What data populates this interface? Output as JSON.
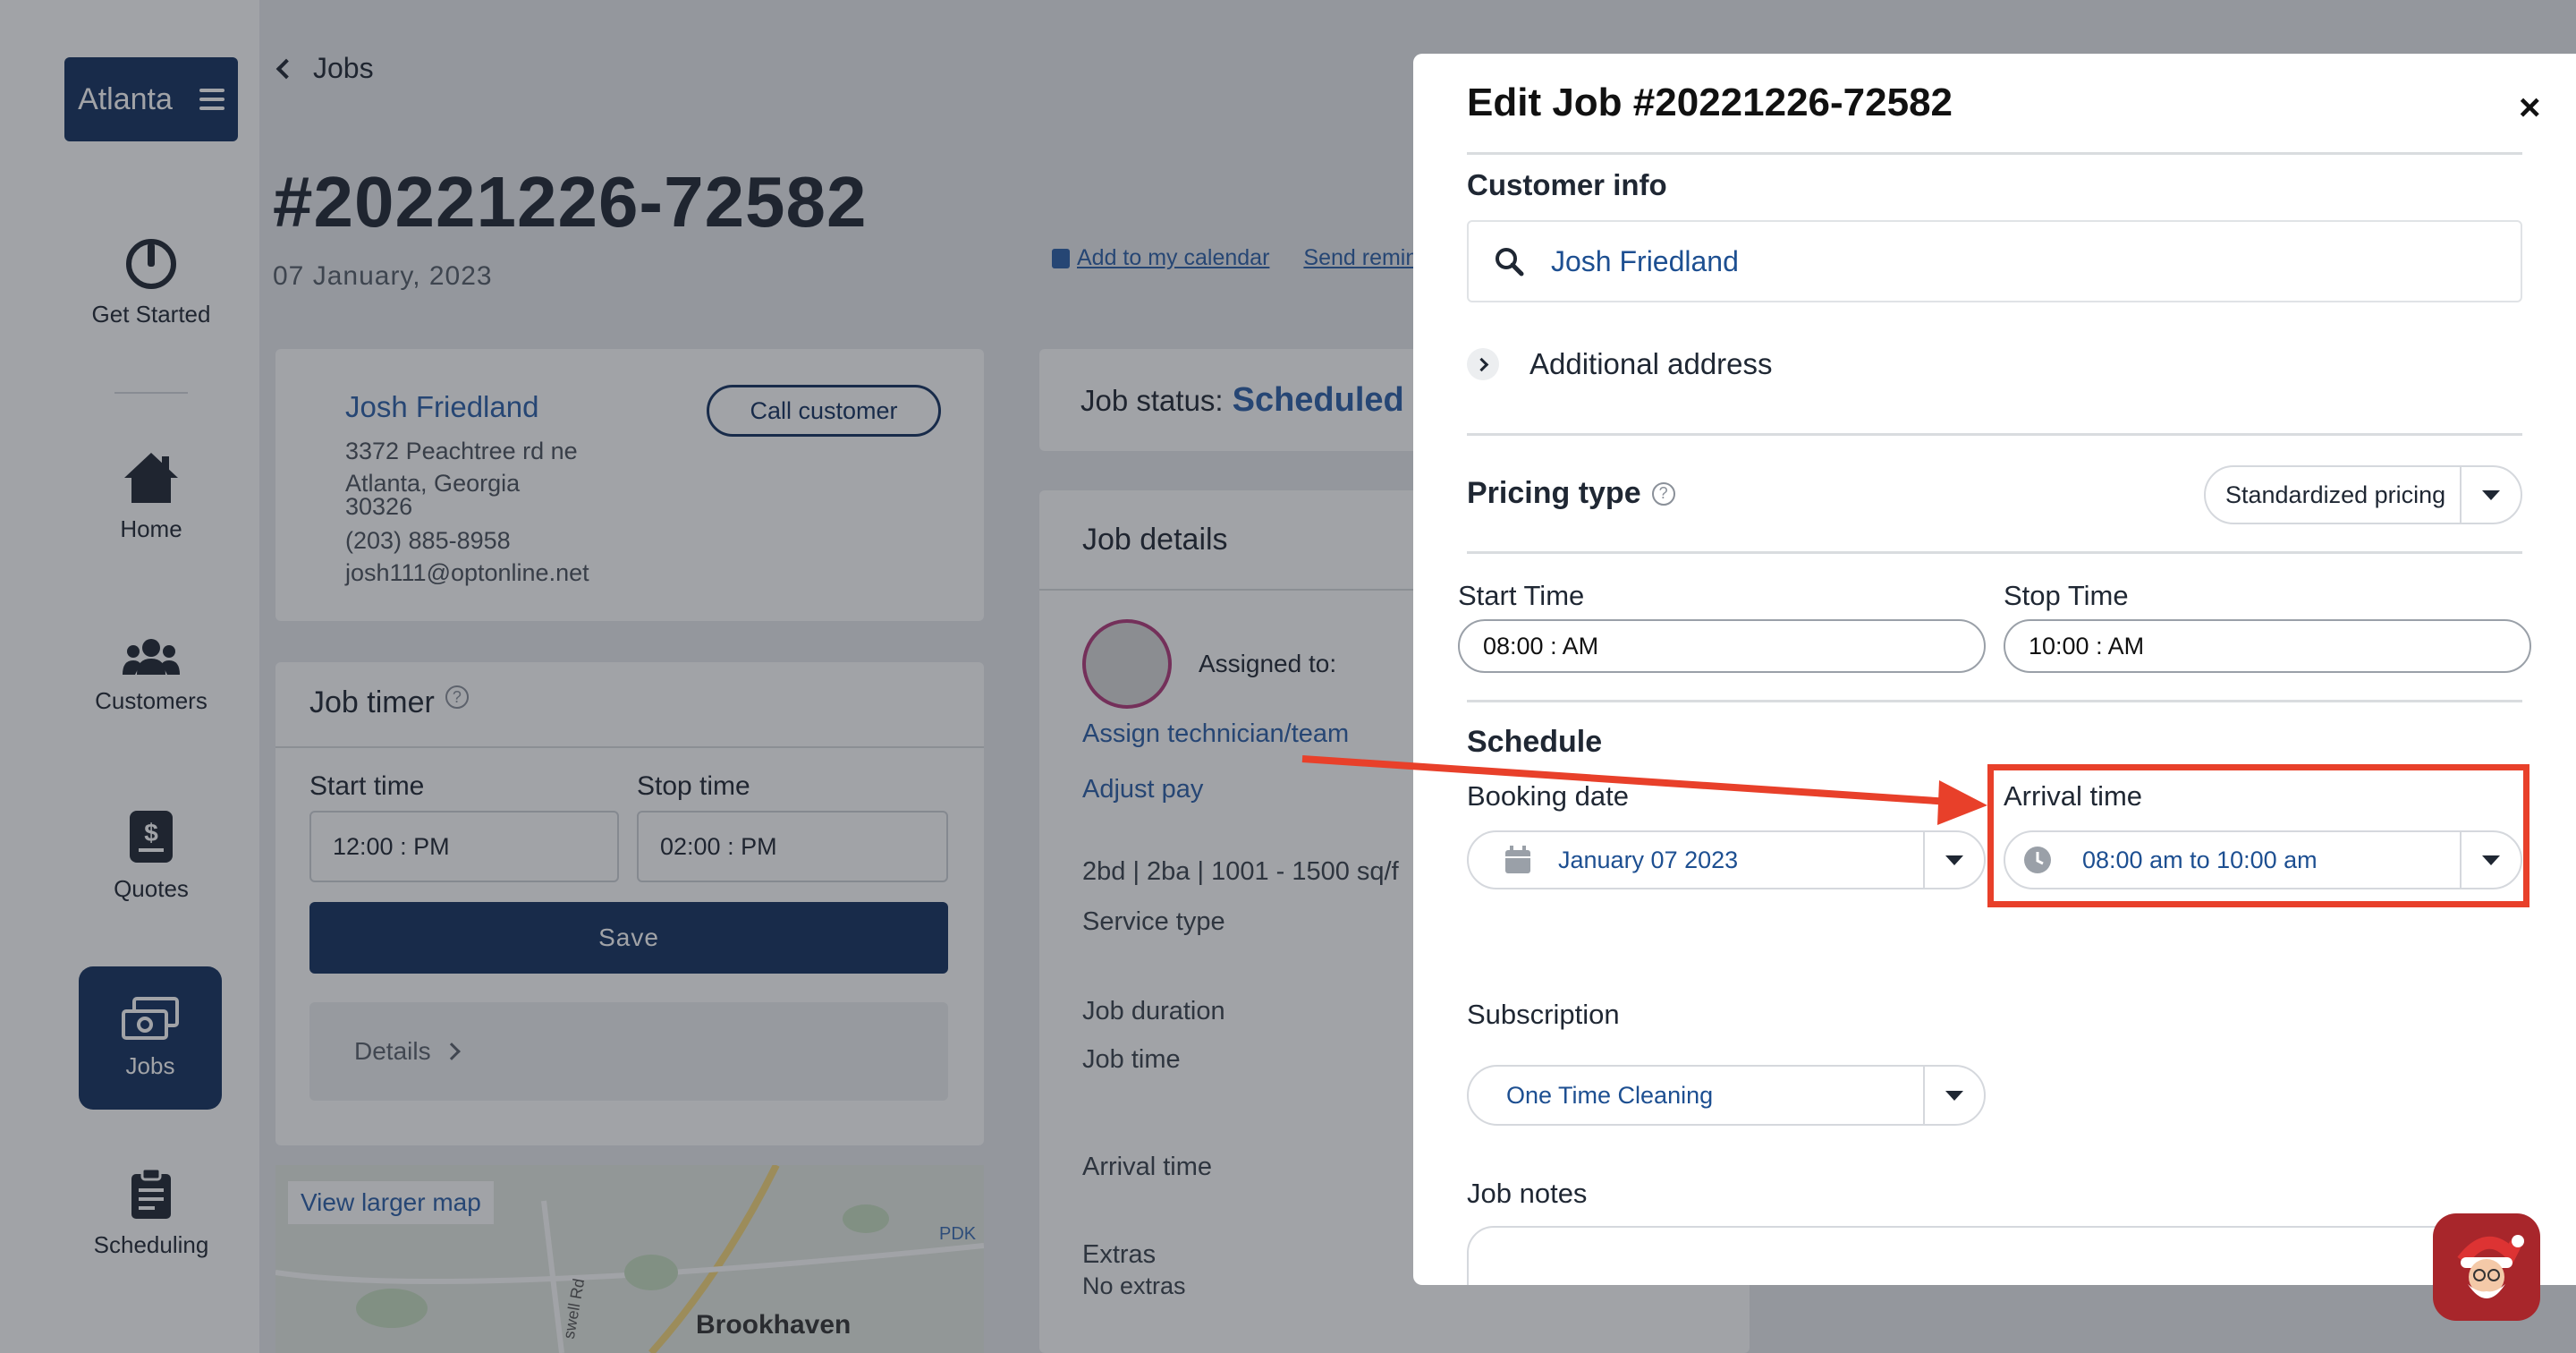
{
  "sidebar": {
    "brand": "Atlanta",
    "items": [
      {
        "label": "Get Started"
      },
      {
        "label": "Home"
      },
      {
        "label": "Customers"
      },
      {
        "label": "Quotes"
      },
      {
        "label": "Jobs"
      },
      {
        "label": "Scheduling"
      }
    ]
  },
  "page": {
    "back_label": "Jobs",
    "job_number": "#20221226-72582",
    "job_date": "07 January, 2023",
    "links": {
      "calendar": "Add to my calendar",
      "reminder": "Send remind"
    }
  },
  "customer_card": {
    "name": "Josh Friedland",
    "address_line1": "3372 Peachtree rd ne",
    "address_line2": "Atlanta, Georgia",
    "zip": "30326",
    "phone": "(203) 885-8958",
    "email": "josh111@optonline.net",
    "call_button": "Call customer"
  },
  "job_timer": {
    "title": "Job timer",
    "start_label": "Start time",
    "stop_label": "Stop time",
    "start_value": "12:00 : PM",
    "stop_value": "02:00 : PM",
    "save_label": "Save",
    "details_label": "Details"
  },
  "map": {
    "link": "View larger map",
    "place": "Brookhaven",
    "airport": "PDK",
    "road": "swell Rd"
  },
  "job_status": {
    "label": "Job status:",
    "value": "Scheduled"
  },
  "job_details": {
    "title": "Job details",
    "assigned_label": "Assigned to:",
    "assign_link": "Assign technician/team",
    "adjust_pay": "Adjust pay",
    "summary": "2bd | 2ba | 1001 - 1500 sq/f",
    "service_type": "Service type",
    "job_duration": "Job duration",
    "job_time": "Job time",
    "arrival_time": "Arrival time",
    "extras_label": "Extras",
    "extras_value": "No extras"
  },
  "modal": {
    "title": "Edit Job #20221226-72582",
    "close": "×",
    "customer_info": {
      "title": "Customer info",
      "search_value": "Josh Friedland",
      "additional_address": "Additional address"
    },
    "pricing": {
      "title": "Pricing type",
      "value": "Standardized pricing"
    },
    "start_time": {
      "label": "Start Time",
      "value": "08:00 : AM"
    },
    "stop_time": {
      "label": "Stop Time",
      "value": "10:00 : AM"
    },
    "schedule": {
      "title": "Schedule",
      "booking_label": "Booking date",
      "booking_value": "January 07 2023",
      "arrival_label": "Arrival time",
      "arrival_value": "08:00 am to 10:00 am"
    },
    "subscription": {
      "label": "Subscription",
      "value": "One Time Cleaning"
    },
    "notes": {
      "label": "Job notes",
      "value": ""
    }
  },
  "colors": {
    "brand_navy": "#14315f",
    "link_blue": "#2c5fa8",
    "highlight_red": "#e8402a"
  }
}
